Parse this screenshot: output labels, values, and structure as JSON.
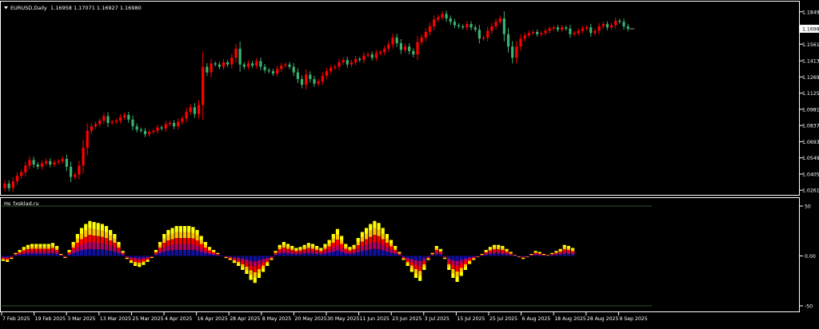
{
  "header": {
    "symbol": "EURUSD,Daily",
    "ohlc": "1.16958 1.17071 1.16927 1.16980",
    "menu_icon": "triangle-down-icon"
  },
  "chart_data": [
    {
      "type": "candlestick",
      "title": "EURUSD,Daily",
      "ylim": [
        1.022,
        1.194
      ],
      "y_ticks": [
        "1.18490",
        "1.16980",
        "1.15610",
        "1.14130",
        "1.12690",
        "1.11250",
        "1.09810",
        "1.08370",
        "1.06930",
        "1.05490",
        "1.04050",
        "1.02610"
      ],
      "current_price": "1.16980",
      "colors": {
        "up": "#ff0000",
        "down": "#3cb371",
        "price_label_bg": "#ffffff"
      },
      "closes": [
        1.032,
        1.028,
        1.034,
        1.039,
        1.042,
        1.048,
        1.053,
        1.049,
        1.047,
        1.05,
        1.052,
        1.049,
        1.051,
        1.052,
        1.054,
        1.047,
        1.038,
        1.04,
        1.048,
        1.064,
        1.079,
        1.083,
        1.085,
        1.088,
        1.092,
        1.086,
        1.087,
        1.088,
        1.091,
        1.093,
        1.089,
        1.083,
        1.08,
        1.079,
        1.076,
        1.078,
        1.079,
        1.082,
        1.081,
        1.085,
        1.086,
        1.083,
        1.087,
        1.09,
        1.096,
        1.1,
        1.094,
        1.102,
        1.136,
        1.131,
        1.139,
        1.138,
        1.136,
        1.14,
        1.138,
        1.144,
        1.152,
        1.138,
        1.136,
        1.139,
        1.137,
        1.141,
        1.136,
        1.133,
        1.132,
        1.13,
        1.134,
        1.137,
        1.138,
        1.136,
        1.131,
        1.125,
        1.12,
        1.129,
        1.125,
        1.121,
        1.123,
        1.128,
        1.132,
        1.135,
        1.136,
        1.14,
        1.142,
        1.138,
        1.14,
        1.143,
        1.142,
        1.146,
        1.147,
        1.144,
        1.148,
        1.149,
        1.152,
        1.156,
        1.162,
        1.157,
        1.151,
        1.154,
        1.15,
        1.147,
        1.158,
        1.162,
        1.167,
        1.172,
        1.178,
        1.18,
        1.183,
        1.179,
        1.176,
        1.173,
        1.172,
        1.171,
        1.174,
        1.171,
        1.169,
        1.161,
        1.162,
        1.168,
        1.172,
        1.176,
        1.179,
        1.165,
        1.154,
        1.144,
        1.154,
        1.161,
        1.164,
        1.166,
        1.167,
        1.165,
        1.166,
        1.168,
        1.17,
        1.171,
        1.169,
        1.171,
        1.17,
        1.165,
        1.166,
        1.168,
        1.17,
        1.171,
        1.166,
        1.168,
        1.172,
        1.174,
        1.171,
        1.173,
        1.177,
        1.176,
        1.172,
        1.1698
      ]
    },
    {
      "type": "bar",
      "title": "Hs_fxsklad.ru",
      "ylim": [
        -50,
        50
      ],
      "y_ticks": [
        "50",
        "0.00",
        "-50"
      ],
      "colors": [
        "#ffff00",
        "#ffc000",
        "#ff0000",
        "#b00060",
        "#1010a0"
      ],
      "values": [
        -5,
        -6,
        -3,
        3,
        6,
        9,
        11,
        12,
        12,
        12,
        12,
        12,
        13,
        10,
        2,
        -2,
        6,
        14,
        22,
        28,
        32,
        35,
        34,
        33,
        32,
        30,
        26,
        22,
        14,
        5,
        -3,
        -7,
        -10,
        -11,
        -9,
        -6,
        -2,
        6,
        14,
        22,
        26,
        28,
        30,
        30,
        30,
        30,
        29,
        26,
        20,
        14,
        9,
        6,
        3,
        0,
        -2,
        -4,
        -7,
        -10,
        -14,
        -18,
        -24,
        -27,
        -22,
        -16,
        -10,
        -4,
        5,
        11,
        14,
        12,
        10,
        8,
        9,
        11,
        13,
        12,
        10,
        8,
        12,
        16,
        22,
        27,
        20,
        12,
        9,
        11,
        18,
        24,
        28,
        32,
        35,
        33,
        28,
        22,
        16,
        10,
        4,
        -4,
        -10,
        -16,
        -22,
        -25,
        -14,
        -4,
        3,
        10,
        7,
        -3,
        -14,
        -22,
        -26,
        -20,
        -14,
        -8,
        -4,
        -1,
        2,
        6,
        9,
        11,
        11,
        10,
        7,
        4,
        1,
        -1,
        -3,
        -1,
        2,
        5,
        4,
        2,
        1,
        3,
        5,
        7,
        11,
        10,
        8
      ]
    }
  ],
  "x_axis": {
    "labels": [
      "7 Feb 2025",
      "19 Feb 2025",
      "3 Mar 2025",
      "13 Mar 2025",
      "25 Mar 2025",
      "4 Apr 2025",
      "16 Apr 2025",
      "28 Apr 2025",
      "8 May 2025",
      "20 May 2025",
      "30 May 2025",
      "11 Jun 2025",
      "23 Jun 2025",
      "3 Jul 2025",
      "15 Jul 2025",
      "25 Jul 2025",
      "6 Aug 2025",
      "18 Aug 2025",
      "28 Aug 2025",
      "9 Sep 2025"
    ]
  }
}
